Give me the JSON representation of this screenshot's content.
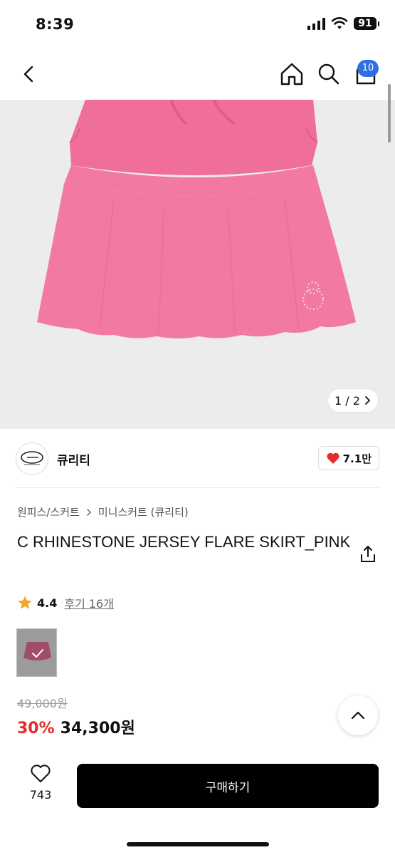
{
  "status": {
    "time": "8:39",
    "battery": "91"
  },
  "nav": {
    "cart_count": "10"
  },
  "image": {
    "counter": "1 / 2"
  },
  "brand": {
    "name": "큐리티",
    "likes": "7.1만"
  },
  "breadcrumb": {
    "category": "원피스/스커트",
    "subcategory": "미니스커트 (큐리티)"
  },
  "product": {
    "title": "C RHINESTONE JERSEY FLARE SKIRT_PINK",
    "rating": "4.4",
    "reviews": "후기 16개",
    "original_price": "49,000원",
    "discount": "30%",
    "price": "34,300원"
  },
  "bottom": {
    "wish_count": "743",
    "buy_label": "구매하기"
  },
  "colors": {
    "accent_blue": "#2f6fe4",
    "discount_red": "#e52b2b",
    "skirt_pink": "#f0749c",
    "star": "#f5a623"
  },
  "icons": [
    "back-icon",
    "home-icon",
    "search-icon",
    "cart-icon",
    "chevron-right-icon",
    "heart-icon",
    "share-icon",
    "star-icon",
    "check-icon",
    "chevron-up-icon"
  ]
}
